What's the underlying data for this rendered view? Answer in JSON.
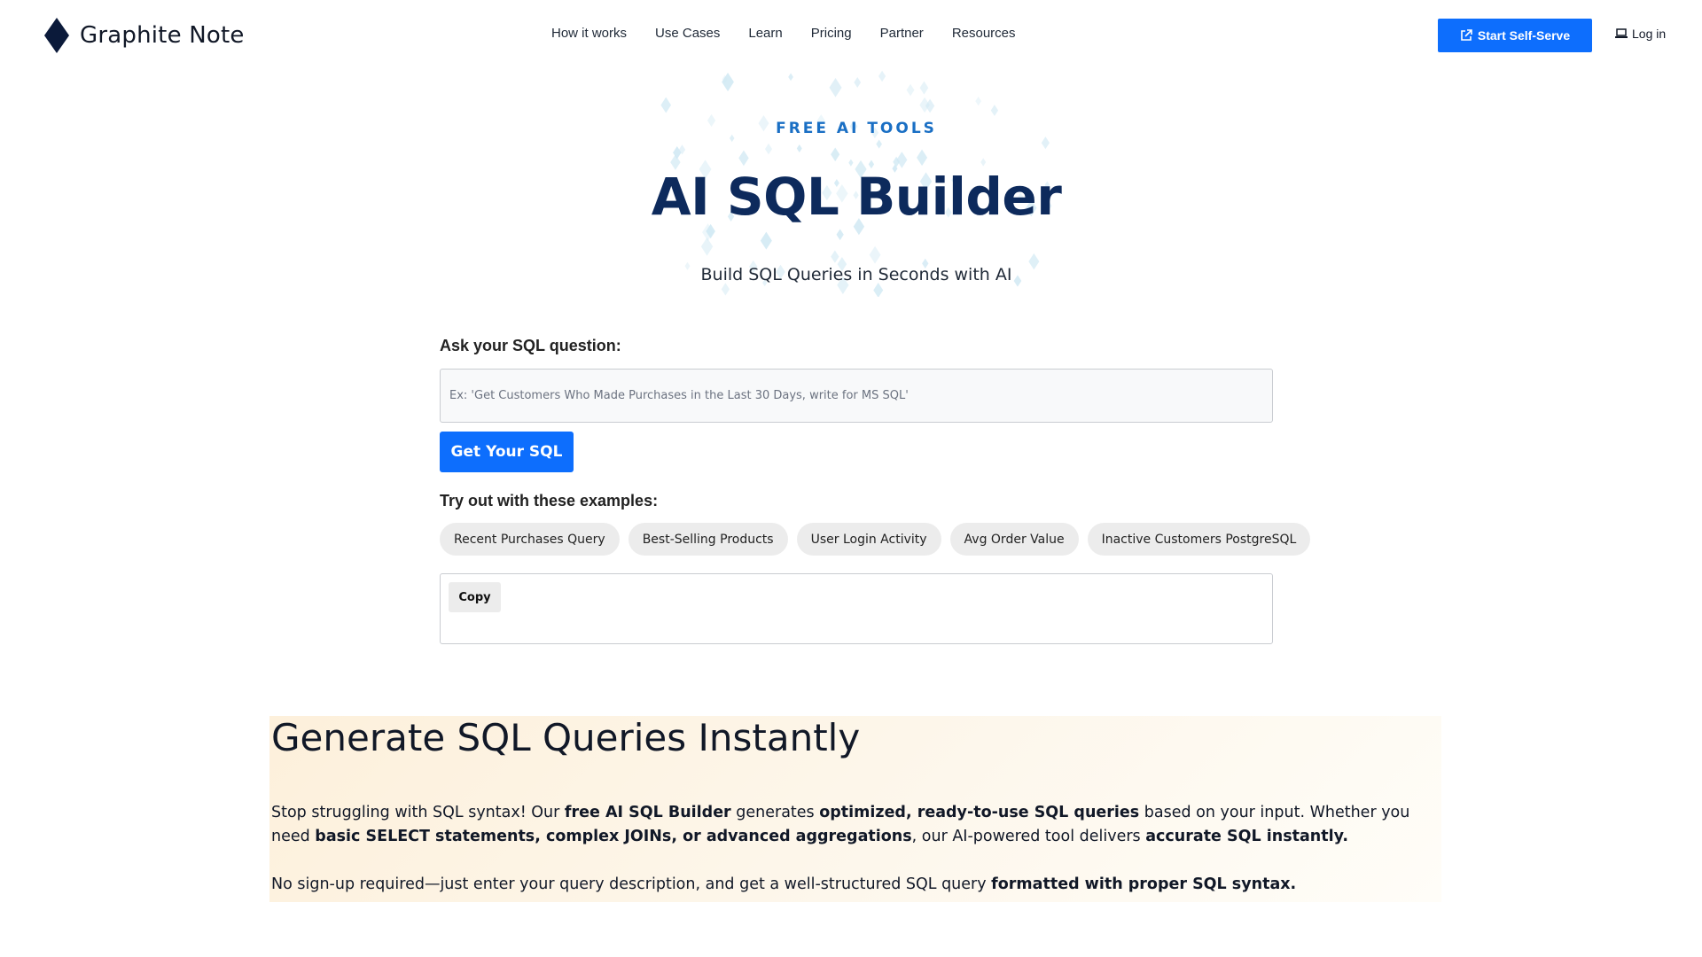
{
  "header": {
    "logo_text": "Graphite Note",
    "nav": [
      "How it works",
      "Use Cases",
      "Learn",
      "Pricing",
      "Partner",
      "Resources"
    ],
    "start_button": "Start Self-Serve",
    "login": "Log in"
  },
  "hero": {
    "eyebrow": "FREE AI TOOLS",
    "title": "AI SQL Builder",
    "subtitle": "Build SQL Queries in Seconds with AI"
  },
  "tool": {
    "question_label": "Ask your SQL question:",
    "question_value": "",
    "question_placeholder": "Ex: 'Get Customers Who Made Purchases in the Last 30 Days, write for MS SQL'",
    "submit_label": "Get Your SQL",
    "examples_label": "Try out with these examples:",
    "examples": [
      "Recent Purchases Query",
      "Best-Selling Products",
      "User Login Activity",
      "Avg Order Value",
      "Inactive Customers PostgreSQL"
    ],
    "copy_label": "Copy"
  },
  "section": {
    "heading": "Generate SQL Queries Instantly",
    "p1": {
      "t1": "Stop struggling with SQL syntax! Our ",
      "b1": "free AI SQL Builder",
      "t2": " generates ",
      "b2": "optimized, ready-to-use SQL queries",
      "t3": " based on your input. Whether you need ",
      "b3": "basic SELECT statements, complex JOINs, or advanced aggregations",
      "t4": ", our AI-powered tool delivers ",
      "b4": "accurate SQL instantly."
    },
    "p2": {
      "t1": "No sign-up required—just enter your query description, and get a well-structured SQL query ",
      "b1": "formatted with proper SQL syntax."
    }
  },
  "colors": {
    "primary": "#0d6efd",
    "title": "#0d2a5c",
    "eyebrow": "#1a6fc4",
    "section_bg": "#fdf0db"
  },
  "icons": {
    "logo": "diamond-icon",
    "start": "external-link-icon",
    "login": "laptop-icon"
  }
}
